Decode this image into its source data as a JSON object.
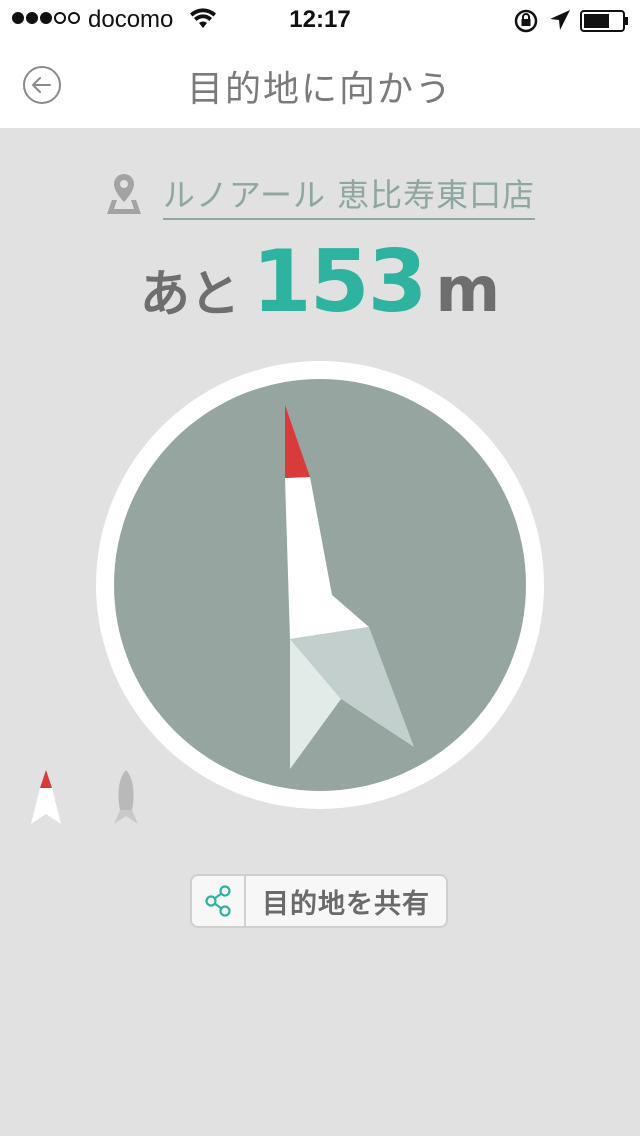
{
  "status_bar": {
    "carrier": "docomo",
    "time": "12:17",
    "signal_bars_filled": 3,
    "signal_bars_total": 5
  },
  "nav": {
    "title": "目的地に向かう",
    "back_icon": "back-arrow-circle-icon"
  },
  "destination": {
    "name": "ルノアール 恵比寿東口店",
    "icon": "map-pin-icon"
  },
  "distance": {
    "prefix": "あと",
    "value": "153",
    "unit": "m"
  },
  "compass": {
    "needle_tip_color": "#d93a3a",
    "needle_color": "#ffffff",
    "dial_color": "#97a5a1",
    "ring_color": "#ffffff"
  },
  "modes": [
    {
      "icon": "north-arrow-icon",
      "active": true
    },
    {
      "icon": "rocket-icon",
      "active": false
    }
  ],
  "share": {
    "label": "目的地を共有",
    "icon": "share-icon",
    "icon_color": "#2db3a0"
  },
  "colors": {
    "accent": "#2db3a0",
    "background": "#e1e1e1",
    "link": "#8fa6a1"
  }
}
